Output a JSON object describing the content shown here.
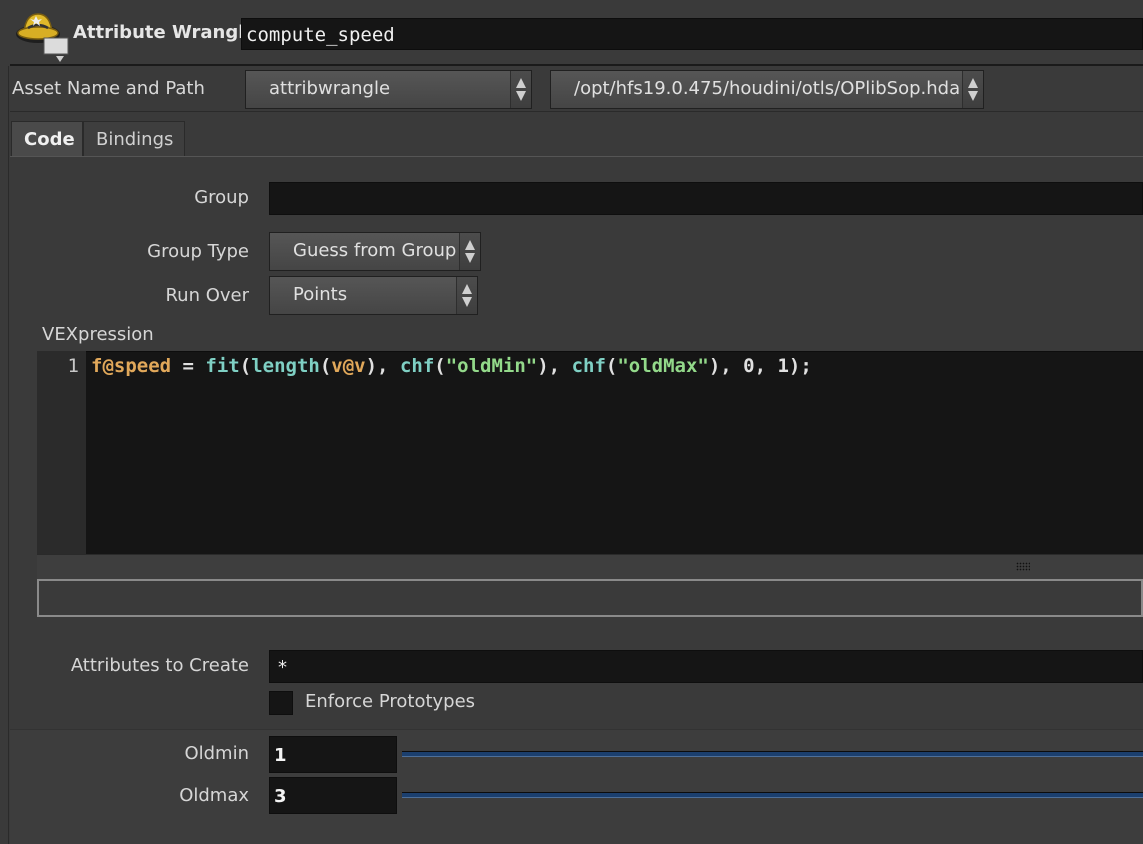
{
  "node": {
    "type_label": "Attribute Wrangle",
    "name": "compute_speed",
    "icon": "wrangle-cowboy-hat-icon"
  },
  "asset": {
    "label": "Asset Name and Path",
    "name": "attribwrangle",
    "path": "/opt/hfs19.0.475/houdini/otls/OPlibSop.hda"
  },
  "tabs": [
    {
      "label": "Code",
      "active": true
    },
    {
      "label": "Bindings",
      "active": false
    }
  ],
  "params": {
    "group_label": "Group",
    "group_value": "",
    "group_type_label": "Group Type",
    "group_type_value": "Guess from Group",
    "run_over_label": "Run Over",
    "run_over_value": "Points",
    "vex_label": "VEXpression",
    "vex_line_number": "1",
    "vex_tokens": [
      {
        "t": "f@speed",
        "c": "attr"
      },
      {
        "t": " = ",
        "c": "plain"
      },
      {
        "t": "fit",
        "c": "func"
      },
      {
        "t": "(",
        "c": "plain"
      },
      {
        "t": "length",
        "c": "func"
      },
      {
        "t": "(",
        "c": "plain"
      },
      {
        "t": "v@v",
        "c": "attr"
      },
      {
        "t": "), ",
        "c": "plain"
      },
      {
        "t": "chf",
        "c": "func"
      },
      {
        "t": "(",
        "c": "plain"
      },
      {
        "t": "\"oldMin\"",
        "c": "str"
      },
      {
        "t": "), ",
        "c": "plain"
      },
      {
        "t": "chf",
        "c": "func"
      },
      {
        "t": "(",
        "c": "plain"
      },
      {
        "t": "\"oldMax\"",
        "c": "str"
      },
      {
        "t": "), 0, 1);",
        "c": "plain"
      }
    ],
    "attributes_label": "Attributes to Create",
    "attributes_value": "*",
    "enforce_label": "Enforce Prototypes",
    "oldmin_label": "Oldmin",
    "oldmin_value": "1",
    "oldmax_label": "Oldmax",
    "oldmax_value": "3"
  },
  "colors": {
    "background": "#3a3a3a",
    "field": "#151515",
    "attr": "#e1a85a",
    "func": "#7fd0c4",
    "string": "#93d98a"
  }
}
